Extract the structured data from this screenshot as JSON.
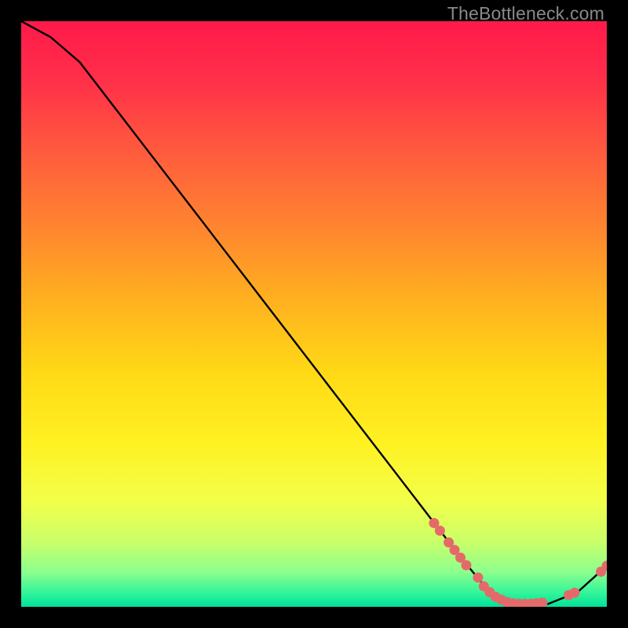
{
  "watermark": "TheBottleneck.com",
  "colors": {
    "line": "#000000",
    "marker": "#e46a6a",
    "frame": "#000000"
  },
  "chart_data": {
    "type": "line",
    "title": "",
    "xlabel": "",
    "ylabel": "",
    "xlim": [
      0,
      100
    ],
    "ylim": [
      0,
      100
    ],
    "grid": false,
    "background": "vertical-gradient red→yellow→green",
    "series": [
      {
        "name": "curve",
        "x": [
          0,
          5,
          10,
          15,
          20,
          25,
          30,
          35,
          40,
          45,
          50,
          55,
          60,
          65,
          70,
          75,
          80,
          85,
          90,
          95,
          100
        ],
        "y": [
          100,
          97.3,
          93.0,
          86.5,
          80.0,
          73.5,
          67.0,
          60.5,
          54.0,
          47.5,
          41.0,
          34.5,
          28.0,
          21.5,
          15.0,
          8.5,
          2.5,
          0.5,
          0.5,
          2.5,
          7.0
        ]
      }
    ],
    "markers": {
      "name": "highlighted-points",
      "x": [
        70.5,
        71.5,
        73.0,
        74.0,
        75.0,
        76.0,
        78.0,
        79.0,
        80.0,
        81.0,
        82.0,
        83.0,
        84.0,
        85.0,
        86.0,
        87.0,
        88.0,
        89.0,
        93.5,
        94.5,
        99.0,
        100.0
      ],
      "y": [
        14.3,
        13.0,
        11.0,
        9.7,
        8.4,
        7.1,
        5.0,
        3.5,
        2.5,
        1.7,
        1.2,
        0.8,
        0.6,
        0.5,
        0.5,
        0.5,
        0.6,
        0.7,
        2.0,
        2.4,
        6.0,
        7.0
      ]
    }
  }
}
